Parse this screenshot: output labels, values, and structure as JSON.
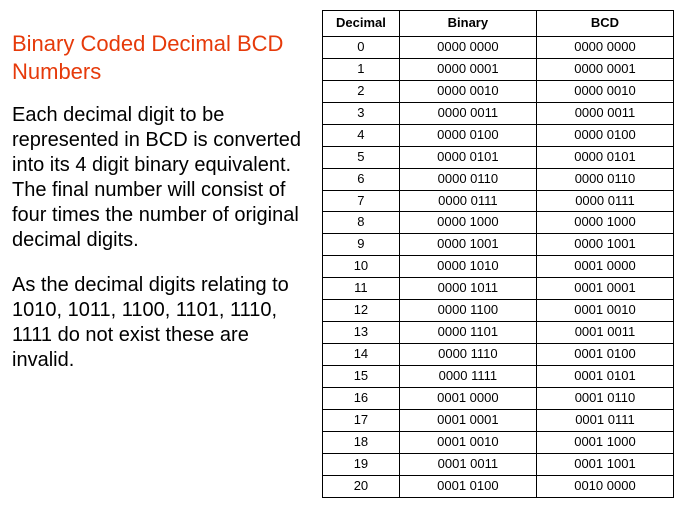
{
  "title": "Binary Coded Decimal BCD Numbers",
  "paragraph1": "Each decimal digit to be represented in BCD is converted into its 4 digit binary equivalent. The final number will consist of four times the number of original decimal digits.",
  "paragraph2": "As the decimal digits relating to 1010, 1011, 1100, 1101, 1110, 1111 do not exist these are invalid.",
  "table": {
    "headers": {
      "decimal": "Decimal",
      "binary": "Binary",
      "bcd": "BCD"
    },
    "rows": [
      {
        "decimal": "0",
        "binary": "0000 0000",
        "bcd": "0000 0000"
      },
      {
        "decimal": "1",
        "binary": "0000 0001",
        "bcd": "0000 0001"
      },
      {
        "decimal": "2",
        "binary": "0000 0010",
        "bcd": "0000 0010"
      },
      {
        "decimal": "3",
        "binary": "0000 0011",
        "bcd": "0000 0011"
      },
      {
        "decimal": "4",
        "binary": "0000 0100",
        "bcd": "0000 0100"
      },
      {
        "decimal": "5",
        "binary": "0000 0101",
        "bcd": "0000 0101"
      },
      {
        "decimal": "6",
        "binary": "0000 0110",
        "bcd": "0000 0110"
      },
      {
        "decimal": "7",
        "binary": "0000 0111",
        "bcd": "0000 0111"
      },
      {
        "decimal": "8",
        "binary": "0000 1000",
        "bcd": "0000 1000"
      },
      {
        "decimal": "9",
        "binary": "0000 1001",
        "bcd": "0000 1001"
      },
      {
        "decimal": "10",
        "binary": "0000 1010",
        "bcd": "0001 0000"
      },
      {
        "decimal": "11",
        "binary": "0000 1011",
        "bcd": "0001 0001"
      },
      {
        "decimal": "12",
        "binary": "0000 1100",
        "bcd": "0001 0010"
      },
      {
        "decimal": "13",
        "binary": "0000 1101",
        "bcd": "0001 0011"
      },
      {
        "decimal": "14",
        "binary": "0000 1110",
        "bcd": "0001 0100"
      },
      {
        "decimal": "15",
        "binary": "0000 1111",
        "bcd": "0001 0101"
      },
      {
        "decimal": "16",
        "binary": "0001 0000",
        "bcd": "0001 0110"
      },
      {
        "decimal": "17",
        "binary": "0001 0001",
        "bcd": "0001 0111"
      },
      {
        "decimal": "18",
        "binary": "0001 0010",
        "bcd": "0001 1000"
      },
      {
        "decimal": "19",
        "binary": "0001 0011",
        "bcd": "0001 1001"
      },
      {
        "decimal": "20",
        "binary": "0001 0100",
        "bcd": "0010 0000"
      }
    ]
  }
}
